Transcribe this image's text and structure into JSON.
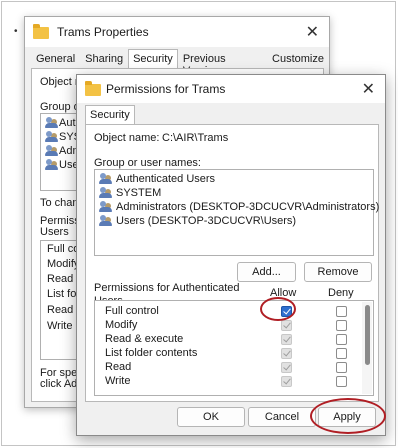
{
  "back_window": {
    "title": "Trams Properties",
    "close_glyph": "✕",
    "tabs": [
      "General",
      "Sharing",
      "Security",
      "Previous Versions",
      "Customize"
    ],
    "object_name_label": "Object na",
    "group_label": "Group or u",
    "groups": [
      "Authe",
      "SYST",
      "Adm",
      "User"
    ],
    "change_label": "To chang",
    "permissions_label_1": "Permissio",
    "permissions_label_2": "Users",
    "permissions": [
      "Full contr",
      "Modify",
      "Read & e",
      "List folde",
      "Read",
      "Write"
    ],
    "special_label_1": "For speci",
    "special_label_2": "click Adv"
  },
  "dialog": {
    "title": "Permissions for Trams",
    "close_glyph": "✕",
    "tab": "Security",
    "object_name_label": "Object name:",
    "object_name_value": "C:\\AIR\\Trams",
    "group_label": "Group or user names:",
    "groups": [
      "Authenticated Users",
      "SYSTEM",
      "Administrators (DESKTOP-3DCUCVR\\Administrators)",
      "Users (DESKTOP-3DCUCVR\\Users)"
    ],
    "add_button": "Add...",
    "remove_button": "Remove",
    "permissions_label_line1": "Permissions for Authenticated",
    "permissions_label_line2": "Users",
    "allow_header": "Allow",
    "deny_header": "Deny",
    "permissions": [
      {
        "name": "Full control",
        "allow": "checked",
        "deny": "unchecked"
      },
      {
        "name": "Modify",
        "allow": "inherited",
        "deny": "unchecked"
      },
      {
        "name": "Read & execute",
        "allow": "inherited",
        "deny": "unchecked"
      },
      {
        "name": "List folder contents",
        "allow": "inherited",
        "deny": "unchecked"
      },
      {
        "name": "Read",
        "allow": "inherited",
        "deny": "unchecked"
      },
      {
        "name": "Write",
        "allow": "inherited",
        "deny": "unchecked"
      }
    ],
    "ok_button": "OK",
    "cancel_button": "Cancel",
    "apply_button": "Apply"
  },
  "colors": {
    "accent": "#2f6fcf",
    "highlight_ring": "#b01e24",
    "folder": "#f3c244"
  },
  "icons": [
    "folder-icon",
    "users-icon",
    "close-icon",
    "checkbox-icon"
  ]
}
